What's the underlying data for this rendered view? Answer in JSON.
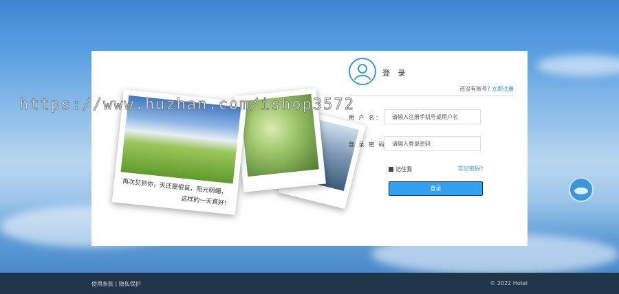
{
  "watermark": "https://www.huzhan.com/ishop3572",
  "photo": {
    "caption_line1": "再次见到你，天还是很蓝，阳光明媚，",
    "caption_line2": "这样的一天真好!"
  },
  "login": {
    "title": "登 录",
    "no_account_text": "还没有账号?",
    "register_link": "立即注册",
    "username_label": "用 户 名：",
    "username_placeholder": "请输入注册手机号或用户名",
    "password_label": "登 录 密 码：",
    "password_placeholder": "请输入登录密码",
    "remember_label": "记住我",
    "forgot_link": "忘记密码?",
    "submit_label": "登录"
  },
  "footer": {
    "left_text": "使用条款 | 隐私保护",
    "right_text": "© 2022 Hotel"
  },
  "colors": {
    "accent": "#32a1f0",
    "link": "#2a8fd6",
    "footer_bg": "#203548"
  },
  "icons": {
    "avatar": "user-icon",
    "float": "globe-icon"
  }
}
